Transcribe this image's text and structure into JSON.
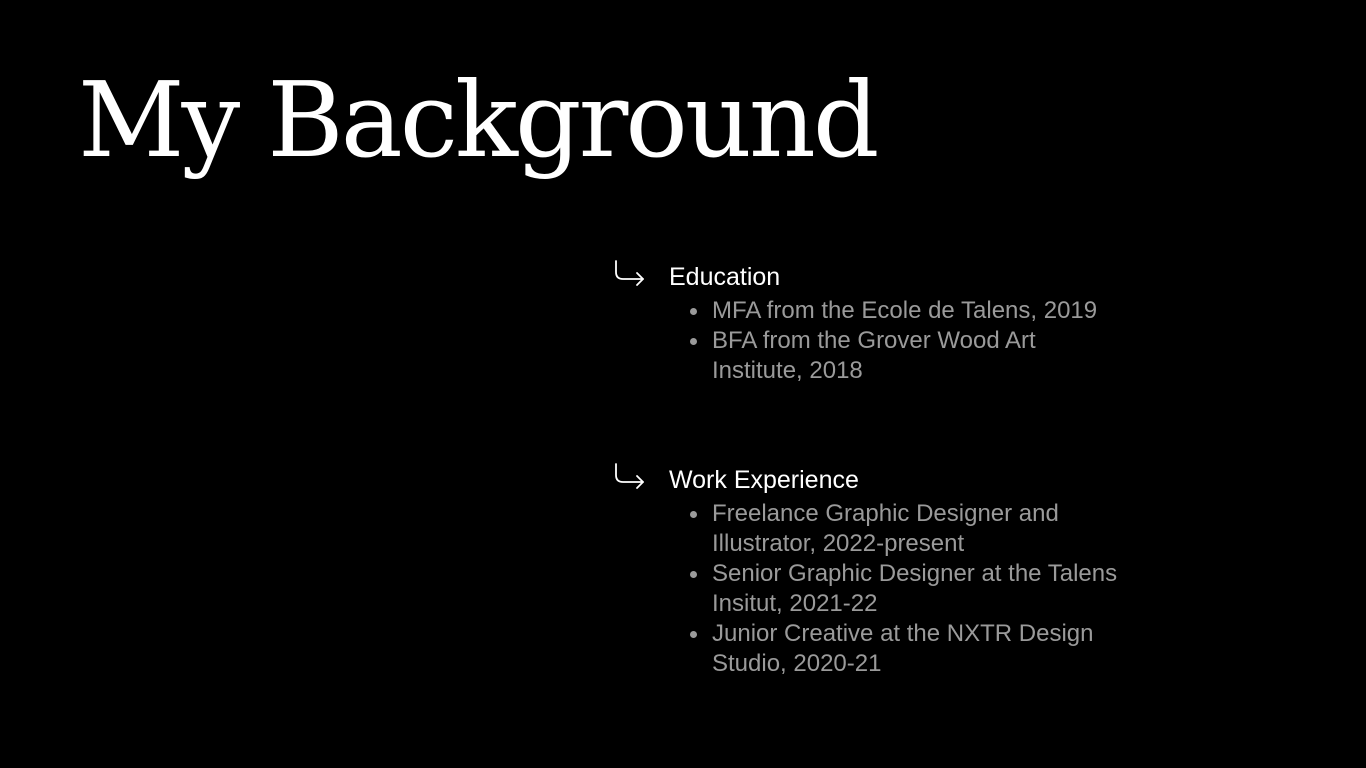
{
  "slide": {
    "title": "My Background",
    "icon": "arrow-turn-down-right-icon",
    "colors": {
      "background": "#000000",
      "heading": "#ffffff",
      "body": "#9a9a9a"
    },
    "sections": [
      {
        "heading": "Education",
        "items": [
          "MFA from the Ecole de Talens, 2019",
          "BFA from the Grover Wood Art Institute, 2018"
        ]
      },
      {
        "heading": "Work Experience",
        "items": [
          "Freelance Graphic Designer and Illustrator, 2022-present",
          "Senior Graphic Designer at the Talens Insitut, 2021-22",
          "Junior Creative at the NXTR Design Studio, 2020-21"
        ]
      }
    ]
  }
}
